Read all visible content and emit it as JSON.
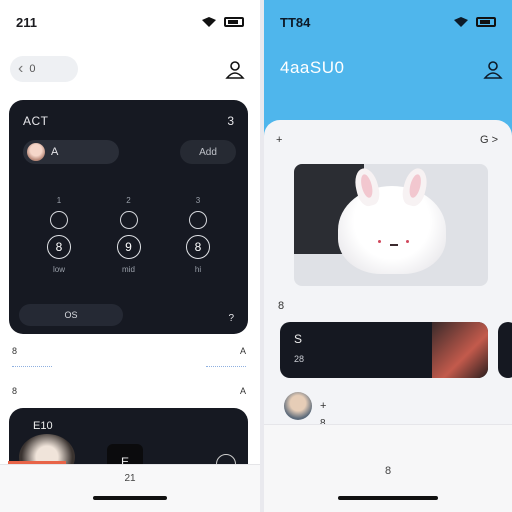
{
  "left": {
    "status_time": "211",
    "back_chip": "0",
    "card": {
      "title": "ACT",
      "count": "3",
      "user_chip": "A",
      "add_button": "Add",
      "controls": [
        {
          "top": "1",
          "mid": "8",
          "label": "low"
        },
        {
          "top": "2",
          "mid": "9",
          "label": "mid"
        },
        {
          "top": "3",
          "mid": "8",
          "label": "hi"
        }
      ],
      "footer": "OS",
      "help": "?"
    },
    "row2": {
      "left": "8",
      "right": "A"
    },
    "row3": {
      "left": "8",
      "right": "A"
    },
    "card2": {
      "title": "E10",
      "b_icon": "E"
    },
    "tab": "21"
  },
  "right": {
    "status_time": "TT84",
    "title": "4aaSU0",
    "sheet": {
      "header_left": "+",
      "header_right": "G >",
      "sub_heading": "8",
      "dark_line1": "S",
      "dark_line2": "28",
      "row_title": "+",
      "row_sub": "8"
    },
    "tab": "8"
  },
  "colors": {
    "accent_blue": "#4fb6ec",
    "dark_card": "#161922",
    "accent_red": "#e86448"
  },
  "icons": [
    "wifi-icon",
    "battery-icon",
    "person-icon",
    "chevron-left-icon",
    "chevron-right-icon"
  ]
}
